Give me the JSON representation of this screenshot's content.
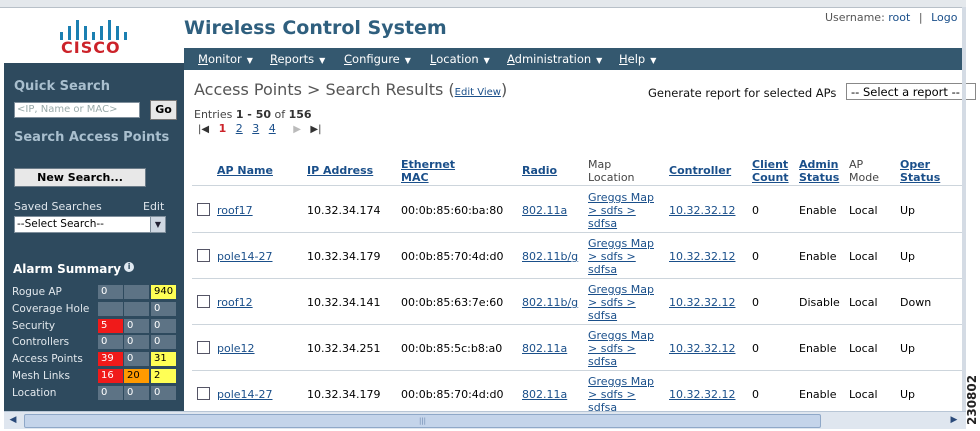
{
  "header": {
    "brand": "CISCO",
    "app_title": "Wireless Control System",
    "username_label": "Username:",
    "username": "root",
    "sep": "|",
    "logout": "Logo"
  },
  "nav": [
    {
      "label": "Monitor",
      "ul": "M",
      "rest": "onitor"
    },
    {
      "label": "Reports",
      "ul": "R",
      "rest": "eports"
    },
    {
      "label": "Configure",
      "ul": "C",
      "rest": "onfigure"
    },
    {
      "label": "Location",
      "ul": "L",
      "rest": "ocation"
    },
    {
      "label": "Administration",
      "ul": "A",
      "rest": "dministration"
    },
    {
      "label": "Help",
      "ul": "H",
      "rest": "elp"
    }
  ],
  "sidebar": {
    "quick_search_title": "Quick Search",
    "search_placeholder": "<IP, Name or MAC>",
    "go_label": "Go",
    "search_aps_title": "Search Access Points",
    "new_search_label": "New Search...",
    "saved_searches_label": "Saved Searches",
    "edit_label": "Edit",
    "saved_select_value": "--Select Search--"
  },
  "alarm_summary": {
    "title": "Alarm Summary",
    "info_icon": "i",
    "rows": [
      {
        "label": "Rogue AP",
        "cells": [
          "0",
          "",
          "940"
        ],
        "colors": [
          "",
          "",
          "yellow"
        ]
      },
      {
        "label": "Coverage Hole",
        "cells": [
          "",
          "",
          "0"
        ],
        "colors": [
          "",
          "",
          ""
        ]
      },
      {
        "label": "Security",
        "cells": [
          "5",
          "0",
          "0"
        ],
        "colors": [
          "red",
          "",
          ""
        ]
      },
      {
        "label": "Controllers",
        "cells": [
          "0",
          "0",
          "0"
        ],
        "colors": [
          "",
          "",
          ""
        ]
      },
      {
        "label": "Access Points",
        "cells": [
          "39",
          "0",
          "31"
        ],
        "colors": [
          "red",
          "",
          "yellow"
        ]
      },
      {
        "label": "Mesh Links",
        "cells": [
          "16",
          "20",
          "2"
        ],
        "colors": [
          "red",
          "orange",
          "yellow"
        ]
      },
      {
        "label": "Location",
        "cells": [
          "0",
          "0",
          "0"
        ],
        "colors": [
          "",
          "",
          ""
        ]
      }
    ]
  },
  "main": {
    "title": "Access Points > Search Results",
    "title_paren_open": "(",
    "edit_view": "Edit View",
    "title_paren_close": ")",
    "report_label": "Generate report for selected APs",
    "report_select": "-- Select a report --",
    "entries_prefix": "Entries",
    "entries_range": "1 - 50",
    "entries_of": "of",
    "entries_total": "156",
    "pages": [
      "1",
      "2",
      "3",
      "4"
    ],
    "current_page": "1"
  },
  "table": {
    "headers": {
      "ap_name": "AP Name",
      "ip": "IP Address",
      "mac_1": "Ethernet",
      "mac_2": "MAC",
      "radio": "Radio",
      "map_1": "Map",
      "map_2": "Location",
      "controller": "Controller",
      "cc_1": "Client",
      "cc_2": "Count",
      "admin_1": "Admin",
      "admin_2": "Status",
      "mode_1": "AP",
      "mode_2": "Mode",
      "oper_1": "Oper",
      "oper_2": "Status"
    },
    "rows": [
      {
        "ap_name": "roof17",
        "ip": "10.32.34.174",
        "mac": "00:0b:85:60:ba:80",
        "radio": "802.11a",
        "map": [
          "Greggs Map",
          "> sdfs >",
          "sdfsa"
        ],
        "controller": "10.32.32.12",
        "clients": "0",
        "admin": "Enable",
        "mode": "Local",
        "oper": "Up"
      },
      {
        "ap_name": "pole14-27",
        "ip": "10.32.34.179",
        "mac": "00:0b:85:70:4d:d0",
        "radio": "802.11b/g",
        "map": [
          "Greggs Map",
          "> sdfs >",
          "sdfsa"
        ],
        "controller": "10.32.32.12",
        "clients": "0",
        "admin": "Enable",
        "mode": "Local",
        "oper": "Up"
      },
      {
        "ap_name": "roof12",
        "ip": "10.32.34.141",
        "mac": "00:0b:85:63:7e:60",
        "radio": "802.11b/g",
        "map": [
          "Greggs Map",
          "> sdfs >",
          "sdfsa"
        ],
        "controller": "10.32.32.12",
        "clients": "0",
        "admin": "Disable",
        "mode": "Local",
        "oper": "Down"
      },
      {
        "ap_name": "pole12",
        "ip": "10.32.34.251",
        "mac": "00:0b:85:5c:b8:a0",
        "radio": "802.11a",
        "map": [
          "Greggs Map",
          "> sdfs >",
          "sdfsa"
        ],
        "controller": "10.32.32.12",
        "clients": "0",
        "admin": "Enable",
        "mode": "Local",
        "oper": "Up"
      },
      {
        "ap_name": "pole14-27",
        "ip": "10.32.34.179",
        "mac": "00:0b:85:70:4d:d0",
        "radio": "802.11a",
        "map": [
          "Greggs Map",
          "> sdfs >",
          "sdfsa"
        ],
        "controller": "10.32.32.12",
        "clients": "0",
        "admin": "Enable",
        "mode": "Local",
        "oper": "Up"
      }
    ]
  },
  "figure_id": "230802"
}
